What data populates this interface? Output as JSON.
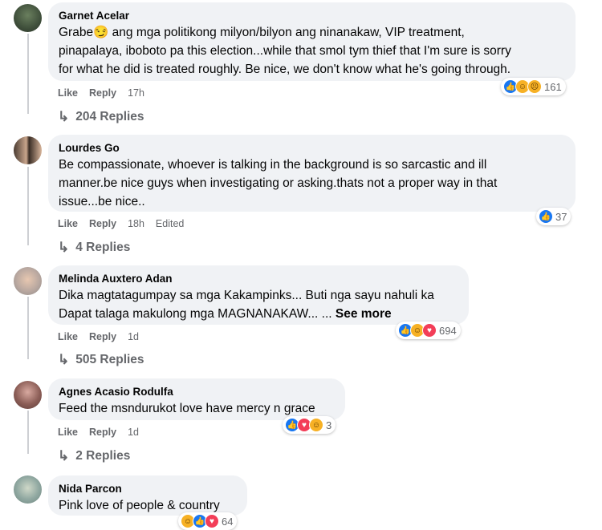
{
  "comments": [
    {
      "author": "Garnet Acelar",
      "text": "Grabe😏 ang mga politikong milyon/bilyon ang ninanakaw, VIP treatment,\npinapalaya, iboboto pa this election...while that smol tym thief that I'm sure is sorry\nfor what he did is treated roughly. Be nice, we don't know what he's going through.",
      "like": "Like",
      "reply": "Reply",
      "time": "17h",
      "edited": "",
      "reactions": [
        "like-icon",
        "haha-icon",
        "sad-icon"
      ],
      "reaction_count": "161",
      "replies_label": "204 Replies"
    },
    {
      "author": "Lourdes Go",
      "text": "Be compassionate, whoever is talking in the background is so sarcastic and ill\nmanner.be nice guys when investigating or asking.thats not a proper way in that\nissue...be nice..",
      "like": "Like",
      "reply": "Reply",
      "time": "18h",
      "edited": "Edited",
      "reactions": [
        "like-icon"
      ],
      "reaction_count": "37",
      "replies_label": "4 Replies"
    },
    {
      "author": "Melinda Auxtero Adan",
      "text": "Dika magtatagumpay sa mga Kakampinks... Buti nga sayu nahuli ka\nDapat talaga makulong mga MAGNANAKAW... ...",
      "see_more": "See more",
      "like": "Like",
      "reply": "Reply",
      "time": "1d",
      "edited": "",
      "reactions": [
        "like-icon",
        "haha-icon",
        "love-icon"
      ],
      "reaction_count": "694",
      "replies_label": "505 Replies"
    },
    {
      "author": "Agnes Acasio Rodulfa",
      "text": "Feed the msndurukot love have mercy n grace",
      "like": "Like",
      "reply": "Reply",
      "time": "1d",
      "edited": "",
      "reactions": [
        "like-icon",
        "love-icon",
        "haha-icon"
      ],
      "reaction_count": "3",
      "replies_label": "2 Replies"
    },
    {
      "author": "Nida Parcon",
      "text": "Pink love of people & country",
      "like": "",
      "reply": "",
      "time": "",
      "edited": "",
      "reactions": [
        "haha-icon",
        "like-icon",
        "love-icon"
      ],
      "reaction_count": "64",
      "replies_label": ""
    }
  ],
  "colors": {
    "bubble": "#f0f2f5",
    "meta_text": "#65676b",
    "like": "#1877f2",
    "love": "#f33e58",
    "haha": "#f7b125",
    "thread_line": "#ced0d4"
  }
}
